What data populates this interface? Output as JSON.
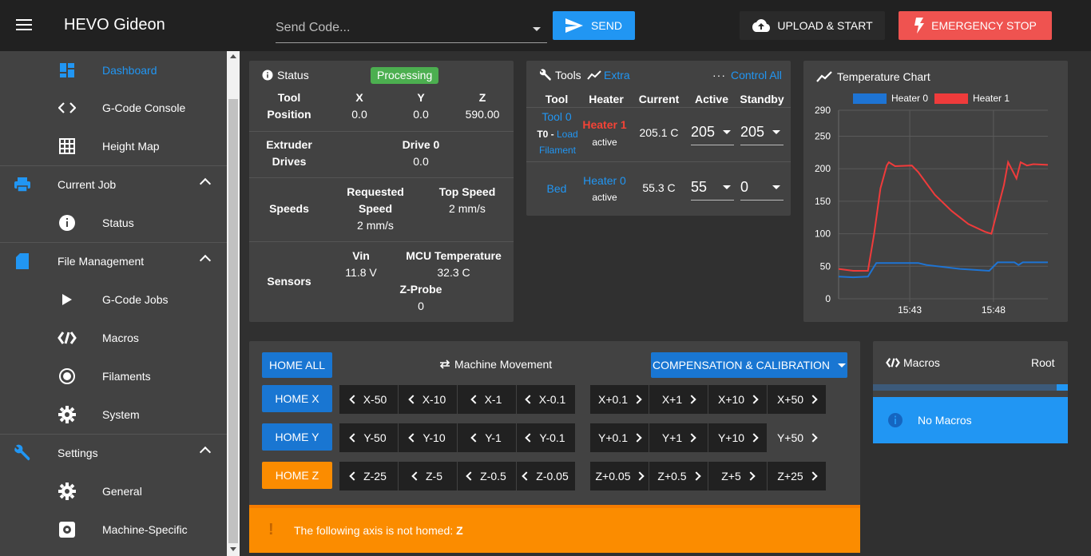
{
  "app": {
    "title": "HEVO Gideon"
  },
  "header": {
    "send_code_placeholder": "Send Code...",
    "send_label": "SEND",
    "upload_label": "UPLOAD & START",
    "estop_label": "EMERGENCY STOP"
  },
  "sidebar": {
    "items": [
      {
        "label": "Dashboard",
        "icon": "dashboard-icon",
        "active": true
      },
      {
        "label": "G-Code Console",
        "icon": "code-icon"
      },
      {
        "label": "Height Map",
        "icon": "grid-icon"
      },
      {
        "label": "Current Job",
        "icon": "printer-icon",
        "group": true
      },
      {
        "label": "Status",
        "icon": "info-icon"
      },
      {
        "label": "File Management",
        "icon": "sd-card-icon",
        "group": true
      },
      {
        "label": "G-Code Jobs",
        "icon": "play-icon"
      },
      {
        "label": "Macros",
        "icon": "macro-icon"
      },
      {
        "label": "Filaments",
        "icon": "radio-icon"
      },
      {
        "label": "System",
        "icon": "gear-icon"
      },
      {
        "label": "Settings",
        "icon": "wrench-icon",
        "group": true
      },
      {
        "label": "General",
        "icon": "gear-icon"
      },
      {
        "label": "Machine-Specific",
        "icon": "gear-box-icon"
      }
    ]
  },
  "status": {
    "title": "Status",
    "state": "Processing",
    "tool_position_label": "Tool Position",
    "tool_label": "Tool",
    "position_label": "Position",
    "axes": [
      {
        "name": "X",
        "value": "0.0"
      },
      {
        "name": "Y",
        "value": "0.0"
      },
      {
        "name": "Z",
        "value": "590.00"
      }
    ],
    "extruder_label": "Extruder",
    "drives_label": "Drives",
    "drive_name": "Drive 0",
    "drive_value": "0.0",
    "speeds_label": "Speeds",
    "requested_label": "Requested",
    "speed_label": "Speed",
    "requested_value": "2 mm/s",
    "top_speed_label": "Top Speed",
    "top_speed_value": "2 mm/s",
    "sensors_label": "Sensors",
    "vin_label": "Vin",
    "vin_value": "11.8 V",
    "mcu_label": "MCU Temperature",
    "mcu_value": "32.3 C",
    "zprobe_label": "Z-Probe",
    "zprobe_value": "0"
  },
  "tools": {
    "title": "Tools",
    "extra_label": "Extra",
    "control_all_label": "Control All",
    "headers": [
      "Tool",
      "Heater",
      "Current",
      "Active",
      "Standby"
    ],
    "rows": [
      {
        "tool": "Tool 0",
        "tool_sub_prefix": "T0 - ",
        "tool_sub_link": "Load",
        "tool_sub_link2": "Filament",
        "heater": "Heater 1",
        "heater_state": "active",
        "current": "205.1 C",
        "active": "205",
        "standby": "205"
      },
      {
        "tool": "Bed",
        "heater": "Heater 0",
        "heater_state": "active",
        "current": "55.3 C",
        "active": "55",
        "standby": "0"
      }
    ]
  },
  "temperature": {
    "title": "Temperature Chart"
  },
  "chart_data": {
    "type": "line",
    "title": "Temperature Chart",
    "xlabel": "",
    "ylabel": "",
    "ylim": [
      0,
      290
    ],
    "yticks": [
      0,
      50,
      100,
      150,
      200,
      250,
      290
    ],
    "xticks": [
      "15:43",
      "15:48"
    ],
    "legend_position": "top",
    "series": [
      {
        "name": "Heater 0",
        "color": "#1e74d4",
        "points": [
          [
            0,
            34
          ],
          [
            0.07,
            33
          ],
          [
            0.14,
            34
          ],
          [
            0.18,
            55
          ],
          [
            0.23,
            55
          ],
          [
            0.38,
            55
          ],
          [
            0.42,
            52
          ],
          [
            0.58,
            46
          ],
          [
            0.72,
            43
          ],
          [
            0.76,
            56
          ],
          [
            0.84,
            56
          ],
          [
            0.86,
            52
          ],
          [
            0.88,
            56
          ],
          [
            1.0,
            56
          ]
        ]
      },
      {
        "name": "Heater 1",
        "color": "#ef3b3b",
        "points": [
          [
            0,
            46
          ],
          [
            0.07,
            43
          ],
          [
            0.14,
            43
          ],
          [
            0.17,
            100
          ],
          [
            0.2,
            170
          ],
          [
            0.23,
            205
          ],
          [
            0.24,
            210
          ],
          [
            0.27,
            204
          ],
          [
            0.35,
            205
          ],
          [
            0.38,
            195
          ],
          [
            0.46,
            160
          ],
          [
            0.54,
            135
          ],
          [
            0.62,
            115
          ],
          [
            0.7,
            103
          ],
          [
            0.73,
            100
          ],
          [
            0.79,
            175
          ],
          [
            0.81,
            210
          ],
          [
            0.85,
            185
          ],
          [
            0.87,
            210
          ],
          [
            0.9,
            205
          ],
          [
            0.93,
            207
          ],
          [
            1.0,
            206
          ]
        ]
      }
    ]
  },
  "movement": {
    "home_all": "HOME ALL",
    "title": "Machine Movement",
    "compensation": "COMPENSATION & CALIBRATION",
    "rows": [
      {
        "home": "HOME X",
        "home_color": "#1976d2",
        "minus": [
          "X-50",
          "X-10",
          "X-1",
          "X-0.1"
        ],
        "plus": [
          "X+0.1",
          "X+1",
          "X+10",
          "X+50"
        ]
      },
      {
        "home": "HOME Y",
        "home_color": "#1976d2",
        "minus": [
          "Y-50",
          "Y-10",
          "Y-1",
          "Y-0.1"
        ],
        "plus": [
          "Y+0.1",
          "Y+1",
          "Y+10",
          "Y+50"
        ]
      },
      {
        "home": "HOME Z",
        "home_color": "#fb8c00",
        "minus": [
          "Z-25",
          "Z-5",
          "Z-0.5",
          "Z-0.05"
        ],
        "plus": [
          "Z+0.05",
          "Z+0.5",
          "Z+5",
          "Z+25"
        ]
      }
    ],
    "warning_text": "The following axis is not homed: ",
    "warning_axis": "Z"
  },
  "macros": {
    "title": "Macros",
    "root_label": "Root",
    "empty_label": "No Macros"
  }
}
